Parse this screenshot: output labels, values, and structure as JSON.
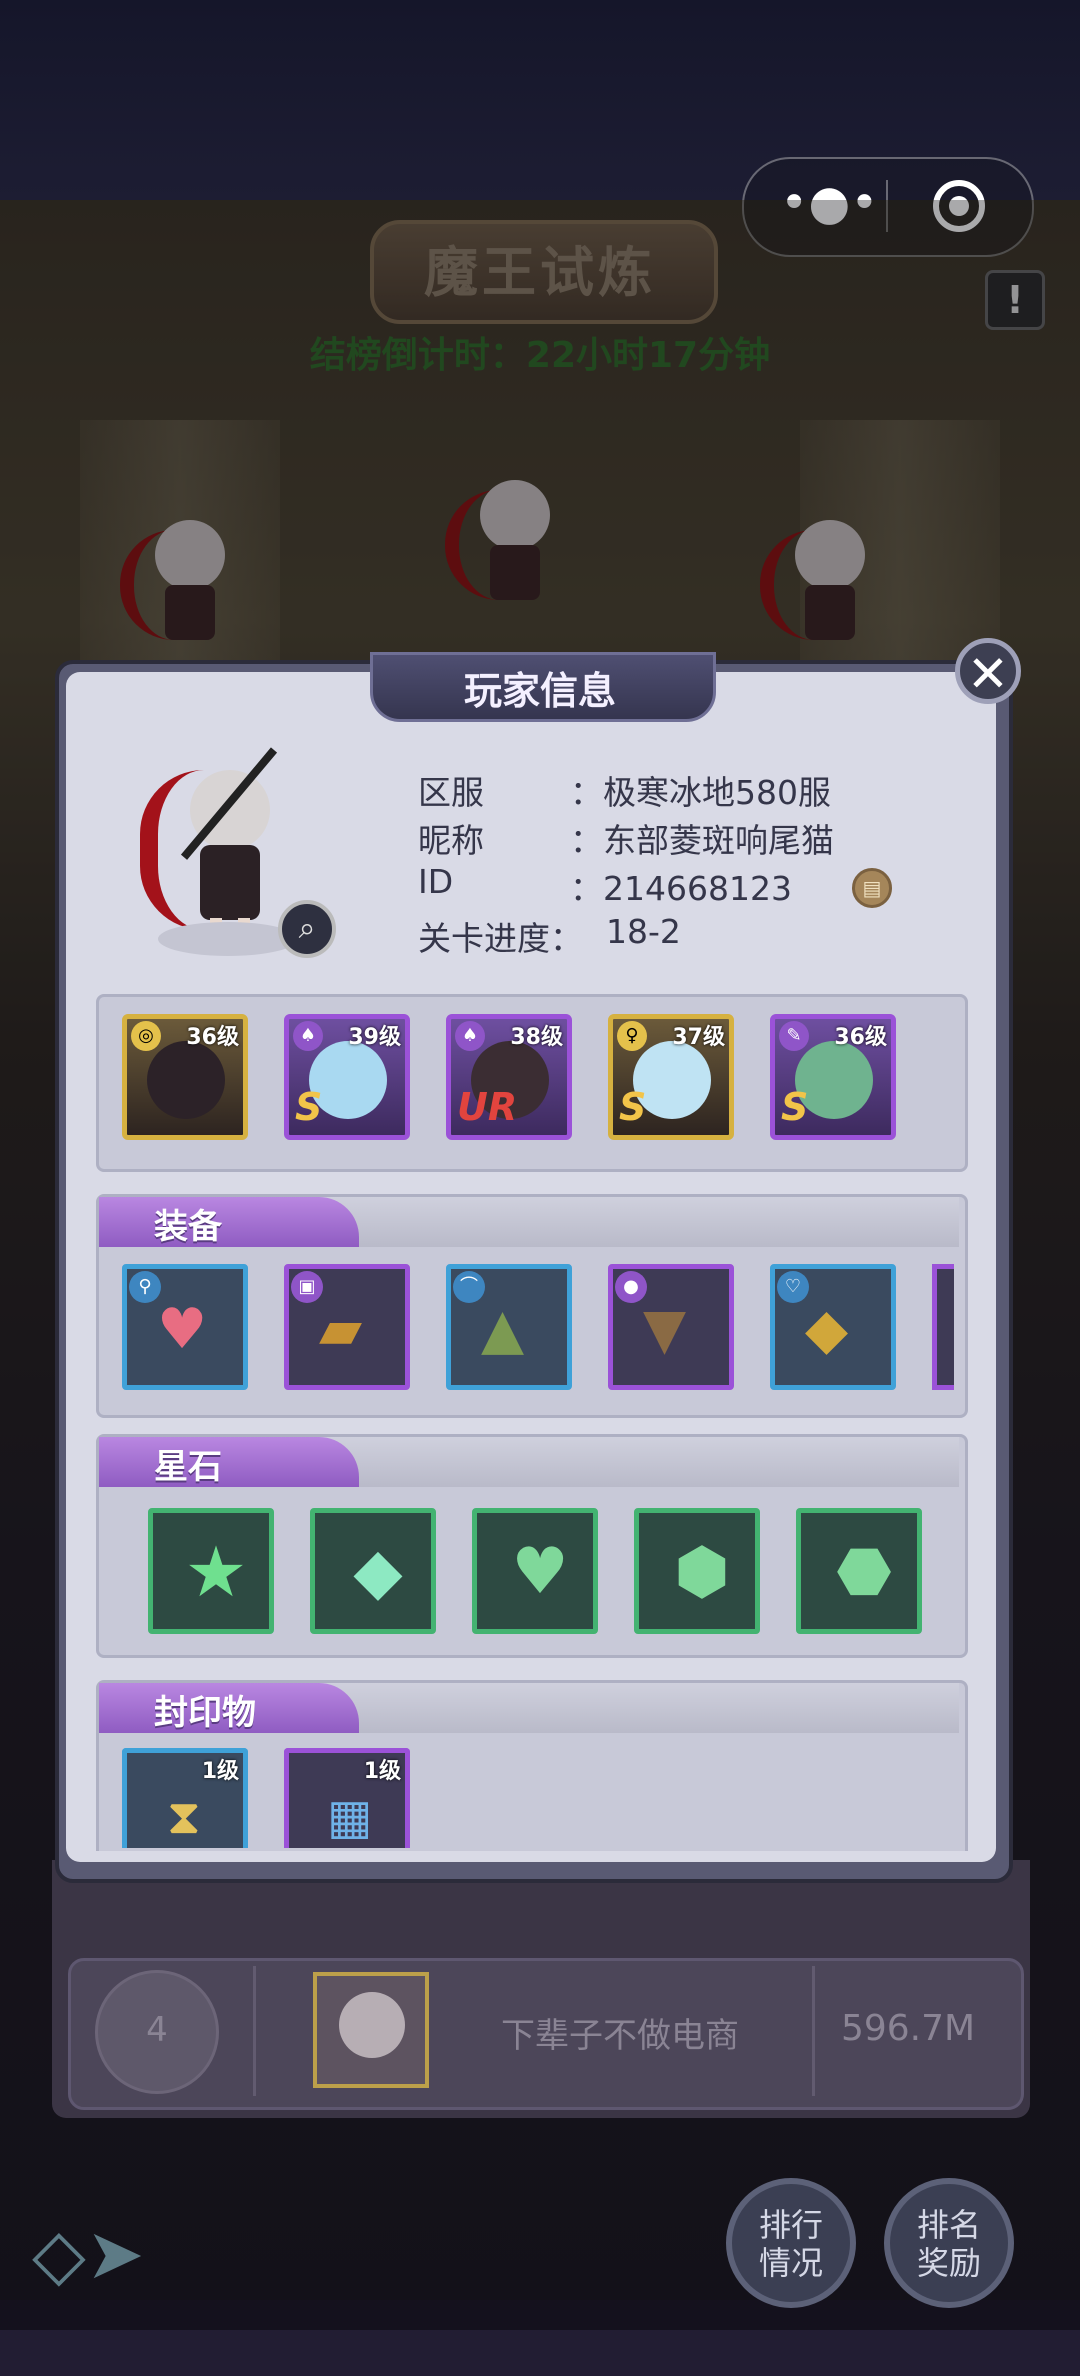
{
  "header": {
    "title": "魔王试炼",
    "countdown": "结榜倒计时：22小时17分钟",
    "info_icon": "exclamation-icon"
  },
  "capsule": {
    "more_icon": "more-dots-icon",
    "close_icon": "target-circle-icon"
  },
  "popup": {
    "title": "玩家信息",
    "close_icon": "close-icon",
    "labels": {
      "server": "区服",
      "nickname": "昵称",
      "id": "ID",
      "progress": "关卡进度："
    },
    "values": {
      "server": "：极寒冰地580服",
      "nickname": "：东部菱斑响尾猫",
      "id": "：214668123",
      "progress": "18-2"
    },
    "heroes": [
      {
        "level": "36级",
        "rarity": "",
        "frame": "gold",
        "badge": "swirl-icon"
      },
      {
        "level": "39级",
        "rarity": "S",
        "frame": "purple",
        "badge": "claw-icon"
      },
      {
        "level": "38级",
        "rarity": "UR",
        "frame": "purple",
        "badge": "claw-icon"
      },
      {
        "level": "37级",
        "rarity": "S",
        "frame": "gold",
        "badge": "staff-icon"
      },
      {
        "level": "36级",
        "rarity": "S",
        "frame": "purple",
        "badge": "feather-icon"
      }
    ],
    "sections": {
      "equipment": "装备",
      "star_stones": "星石",
      "seals": "封印物"
    },
    "equipment": [
      {
        "name": "heart-wand-icon",
        "frame": "blue"
      },
      {
        "name": "spell-book-icon",
        "frame": "purple"
      },
      {
        "name": "green-hat-icon",
        "frame": "blue"
      },
      {
        "name": "cloak-icon",
        "frame": "purple"
      },
      {
        "name": "gold-ring-icon",
        "frame": "blue"
      }
    ],
    "star_stones": [
      "star-gem-icon",
      "crystal-gem-icon",
      "heart-gem-icon",
      "round-gem-icon",
      "hex-gem-icon"
    ],
    "seals": [
      {
        "level": "1级",
        "frame": "blue",
        "name": "hourglass-icon"
      },
      {
        "level": "1级",
        "frame": "purple",
        "name": "chip-icon"
      }
    ]
  },
  "ranking": {
    "rank": "4",
    "name": "下辈子不做电商",
    "score": "596.7M"
  },
  "bottom": {
    "rank_button": "排行\n情况",
    "reward_button": "排名\n奖励"
  }
}
